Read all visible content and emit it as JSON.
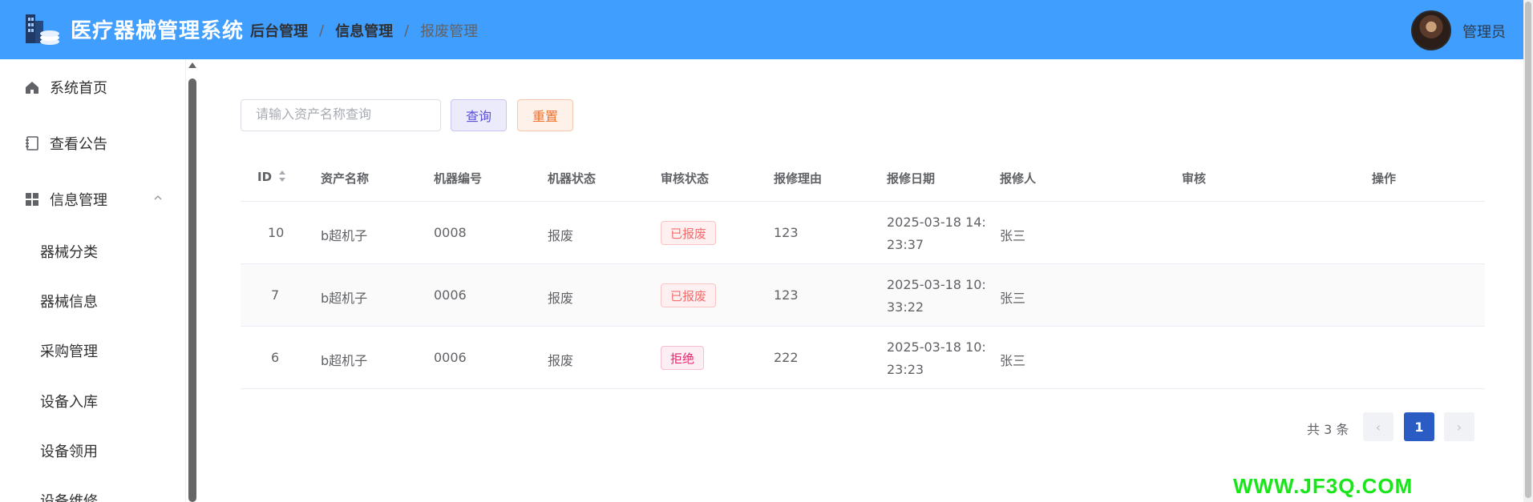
{
  "header": {
    "title": "医疗器械管理系统",
    "breadcrumb": [
      "后台管理",
      "信息管理",
      "报废管理"
    ],
    "user": "管理员"
  },
  "sidebar": {
    "items": [
      {
        "label": "系统首页",
        "icon": "home-icon"
      },
      {
        "label": "查看公告",
        "icon": "notebook-icon"
      },
      {
        "label": "信息管理",
        "icon": "grid-icon",
        "expanded": true
      }
    ],
    "sub_items": [
      "器械分类",
      "器械信息",
      "采购管理",
      "设备入库",
      "设备领用",
      "设备维修"
    ]
  },
  "search": {
    "placeholder": "请输入资产名称查询",
    "value": "",
    "query_label": "查询",
    "reset_label": "重置"
  },
  "table": {
    "headers": [
      "ID",
      "资产名称",
      "机器编号",
      "机器状态",
      "审核状态",
      "报修理由",
      "报修日期",
      "报修人",
      "审核",
      "操作"
    ],
    "rows": [
      {
        "id": "10",
        "name": "b超机子",
        "code": "0008",
        "status": "报废",
        "audit": "已报废",
        "audit_type": "done",
        "reason": "123",
        "date1": "2025-03-18 14:",
        "date2": "23:37",
        "person": "张三"
      },
      {
        "id": "7",
        "name": "b超机子",
        "code": "0006",
        "status": "报废",
        "audit": "已报废",
        "audit_type": "done",
        "reason": "123",
        "date1": "2025-03-18 10:",
        "date2": "33:22",
        "person": "张三"
      },
      {
        "id": "6",
        "name": "b超机子",
        "code": "0006",
        "status": "报废",
        "audit": "拒绝",
        "audit_type": "reject",
        "reason": "222",
        "date1": "2025-03-18 10:",
        "date2": "23:23",
        "person": "张三"
      }
    ]
  },
  "pagination": {
    "total": "共 3 条",
    "current": "1",
    "prev": "‹",
    "next": "›"
  },
  "watermark": "WWW.JF3Q.COM",
  "colors": {
    "header": "#409eff",
    "active_page": "#2a5cc4",
    "watermark": "#19e619"
  }
}
